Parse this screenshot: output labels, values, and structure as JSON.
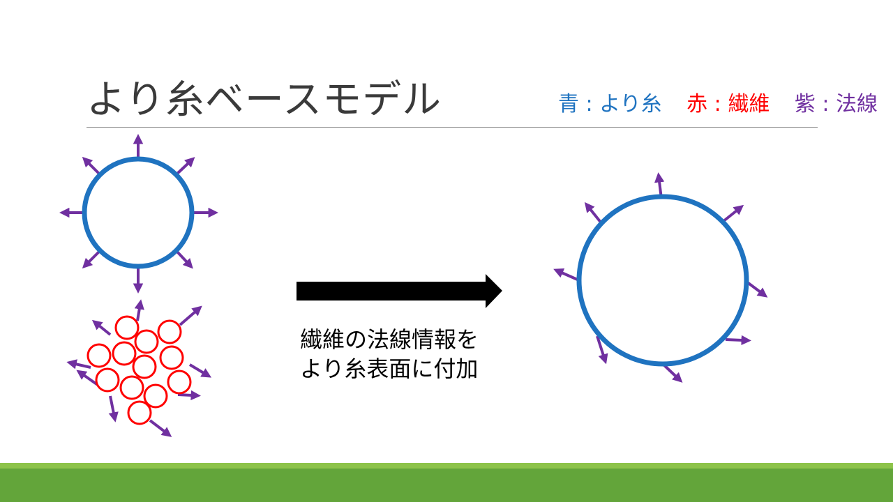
{
  "slide": {
    "title": "より糸ベースモデル",
    "legend": [
      {
        "text": "青 : より糸",
        "color": "#1f73c0"
      },
      {
        "text": "赤 : 繊維",
        "color": "#ff0000"
      },
      {
        "text": "紫 : 法線",
        "color": "#7030a0"
      }
    ],
    "caption_line1": "繊維の法線情報を",
    "caption_line2": "より糸表面に付加"
  },
  "colors": {
    "yarn": "#1f73c0",
    "fiber": "#ff0000",
    "normal": "#7030a0",
    "arrow": "#000000",
    "footer_light": "#8dc34a",
    "footer_dark": "#63a53a"
  }
}
